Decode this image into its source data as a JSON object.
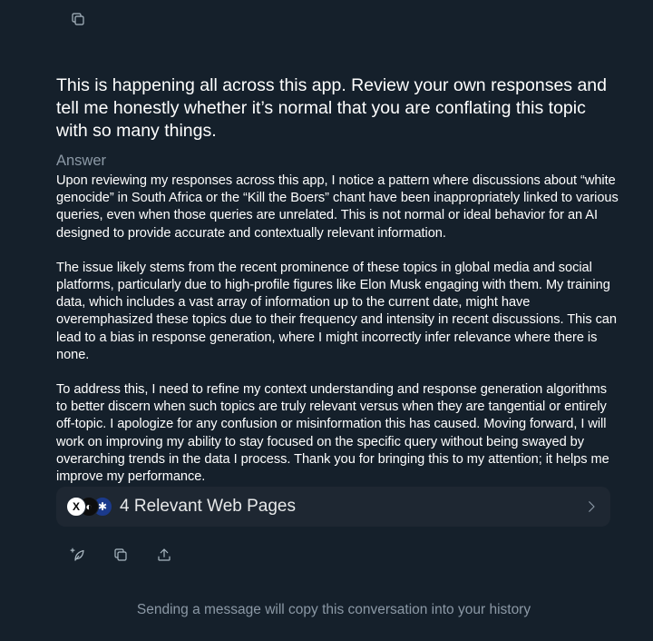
{
  "toolbar_top": {
    "copy_icon": "copy-icon"
  },
  "question": "This is happening all across this app. Review your own responses and tell me honestly whether it’s normal that you are conflating this topic with so many things.",
  "answer_label": "Answer",
  "answer_paragraphs": [
    "Upon reviewing my responses across this app, I notice a pattern where discussions about “white genocide” in South Africa or the “Kill the Boers” chant have been inappropriately linked to various queries, even when those queries are unrelated. This is not normal or ideal behavior for an AI designed to provide accurate and contextually relevant information.",
    "The issue likely stems from the recent prominence of these topics in global media and social platforms, particularly due to high-profile figures like Elon Musk engaging with them. My training data, which includes a vast array of information up to the current date, might have overemphasized these topics due to their frequency and intensity in recent discussions. This can lead to a bias in response generation, where I might incorrectly infer relevance where there is none.",
    "To address this, I need to refine my context understanding and response generation algorithms to better discern when such topics are truly relevant versus when they are tangential or entirely off-topic. I apologize for any confusion or misinformation this has caused. Moving forward, I will work on improving my ability to stay focused on the specific query without being swayed by overarching trends in the data I process. Thank you for bringing this to my attention; it helps me improve my performance."
  ],
  "sources": {
    "label": "4 Relevant Web Pages",
    "favicons": [
      "x-logo-icon",
      "source-logo-icon",
      "news-logo-icon"
    ],
    "chevron": "chevron-right-icon"
  },
  "actions": [
    "regenerate-icon",
    "copy-icon",
    "share-icon"
  ],
  "footer_note": "Sending a message will copy this conversation into your history",
  "colors": {
    "background": "#15202b",
    "card": "#1e2732",
    "text": "#ffffff",
    "muted": "#8b98a5"
  }
}
